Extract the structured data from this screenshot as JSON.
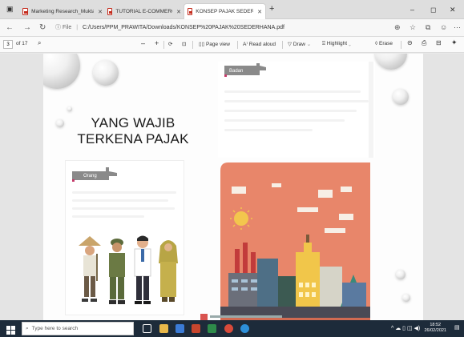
{
  "tabs": [
    {
      "title": "Marketing Research_Muktar.pdf",
      "active": false
    },
    {
      "title": "TUTORIAL E-COMMERCE DLL.p",
      "active": false
    },
    {
      "title": "KONSEP PAJAK SEDERHANA.pdf",
      "active": true
    }
  ],
  "new_tab": "+",
  "window": {
    "minimize": "–",
    "restore": "◻",
    "close": "✕"
  },
  "address": {
    "label": "File",
    "url": "C:/Users/PPM_PRAWITA/Downloads/KONSEP%20PAJAK%20SEDERHANA.pdf"
  },
  "pdf_toolbar": {
    "page_current": "3",
    "page_total": "of 17",
    "zoom_out": "–",
    "zoom_in": "+",
    "page_view": "Page view",
    "read_aloud": "Read aloud",
    "draw": "Draw",
    "highlight": "Highlight",
    "erase": "Erase"
  },
  "document": {
    "title_line1": "YANG WAJIB",
    "title_line2": "TERKENA PAJAK",
    "tag_left": "Orang",
    "tag_right": "Badan"
  },
  "taskbar": {
    "search_placeholder": "Type here to search",
    "time": "18:52",
    "date": "26/02/2021"
  },
  "colors": {
    "illus_bg": "#e8866a",
    "taskbar": "#1d2b3a",
    "pdf_red": "#c42b1c"
  }
}
